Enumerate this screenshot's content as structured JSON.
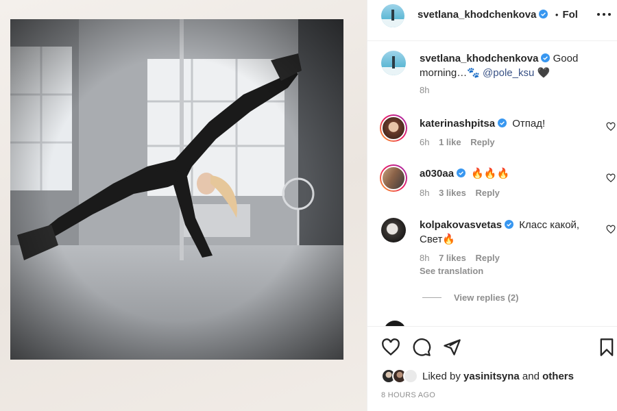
{
  "header": {
    "username": "svetlana_khodchenkova",
    "separator": "•",
    "follow_label": "Fol",
    "more_icon": "more-horizontal-icon"
  },
  "caption": {
    "username": "svetlana_khodchenkova",
    "text_before": "Good morning…🐾 ",
    "mention": "@pole_ksu",
    "text_after": " 🖤",
    "time": "8h"
  },
  "comments": [
    {
      "username": "katerinashpitsa",
      "text": "Отпад!",
      "time": "6h",
      "likes": "1 like",
      "reply": "Reply"
    },
    {
      "username": "a030aa",
      "text": "🔥🔥🔥",
      "time": "8h",
      "likes": "3 likes",
      "reply": "Reply"
    },
    {
      "username": "kolpakovasvetas",
      "text": "Класс какой, Свет🔥",
      "time": "8h",
      "likes": "7 likes",
      "reply": "Reply",
      "see_translation": "See translation",
      "view_replies": "View replies (2)"
    }
  ],
  "actions": {
    "liked_by_prefix": "Liked by ",
    "liked_by_user": "yasinitsyna",
    "liked_by_and": " and ",
    "liked_by_others": "others",
    "timestamp": "8 HOURS AGO"
  },
  "colors": {
    "verified": "#3897f0",
    "text": "#262626",
    "muted": "#8e8e8e",
    "ring_start": "#f9a825",
    "ring_end": "#c2185b"
  }
}
